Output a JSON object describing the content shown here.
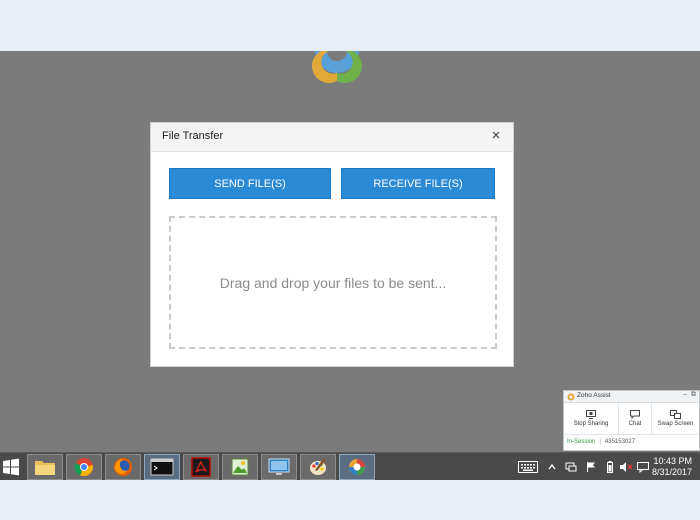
{
  "dialog": {
    "title": "File Transfer",
    "close_symbol": "×",
    "send_label": "SEND FILE(S)",
    "receive_label": "RECEIVE FILE(S)",
    "drop_text": "Drag and drop your files to be sent..."
  },
  "zoho": {
    "title": "Zoho Assist",
    "minimize_symbol": "–",
    "popout_symbol": "⧉",
    "actions": [
      "Stop Sharing",
      "Chat",
      "Swap Screen"
    ],
    "status": "In-Session",
    "session_id": "435153027"
  },
  "taskbar": {
    "time": "10:43 PM",
    "date": "8/31/2017",
    "icons": [
      "file-explorer-icon",
      "chrome-icon",
      "firefox-icon",
      "terminal-icon",
      "acrobat-icon",
      "image-viewer-icon",
      "remote-desktop-icon",
      "paint-icon",
      "zoho-assist-icon"
    ]
  },
  "colors": {
    "button_blue": "#2a8ad6",
    "desktop_gray": "#7b7b7b",
    "taskbar": "#4a4a4a",
    "session_green": "#2e9e3f"
  }
}
